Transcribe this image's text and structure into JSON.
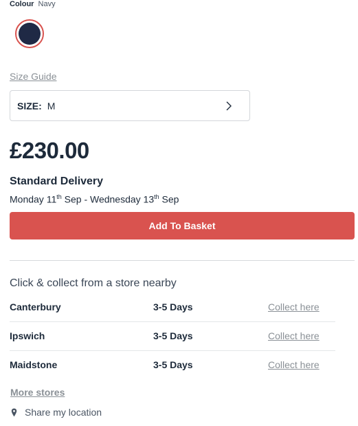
{
  "colour": {
    "label": "Colour",
    "value": "Navy",
    "swatch_color": "#1f2945",
    "selected_ring_color": "#d9534f"
  },
  "size_guide": {
    "label": "Size Guide"
  },
  "size_select": {
    "label": "SIZE:",
    "value": "M",
    "icon": "chevron-right-icon"
  },
  "price": "£230.00",
  "delivery": {
    "title": "Standard Delivery",
    "start_day": "Monday 11",
    "start_suffix": "th",
    "start_month": " Sep - Wednesday 13",
    "end_suffix": "th",
    "end_month": " Sep"
  },
  "basket_button": {
    "label": "Add To Basket",
    "color": "#d9534f"
  },
  "collect": {
    "heading": "Click & collect from a store nearby",
    "stores": [
      {
        "name": "Canterbury",
        "days": "3-5 Days",
        "action": "Collect here"
      },
      {
        "name": "Ipswich",
        "days": "3-5 Days",
        "action": "Collect here"
      },
      {
        "name": "Maidstone",
        "days": "3-5 Days",
        "action": "Collect here"
      }
    ],
    "more_stores": "More stores",
    "share_location": "Share my location",
    "share_icon": "map-pin-icon"
  }
}
